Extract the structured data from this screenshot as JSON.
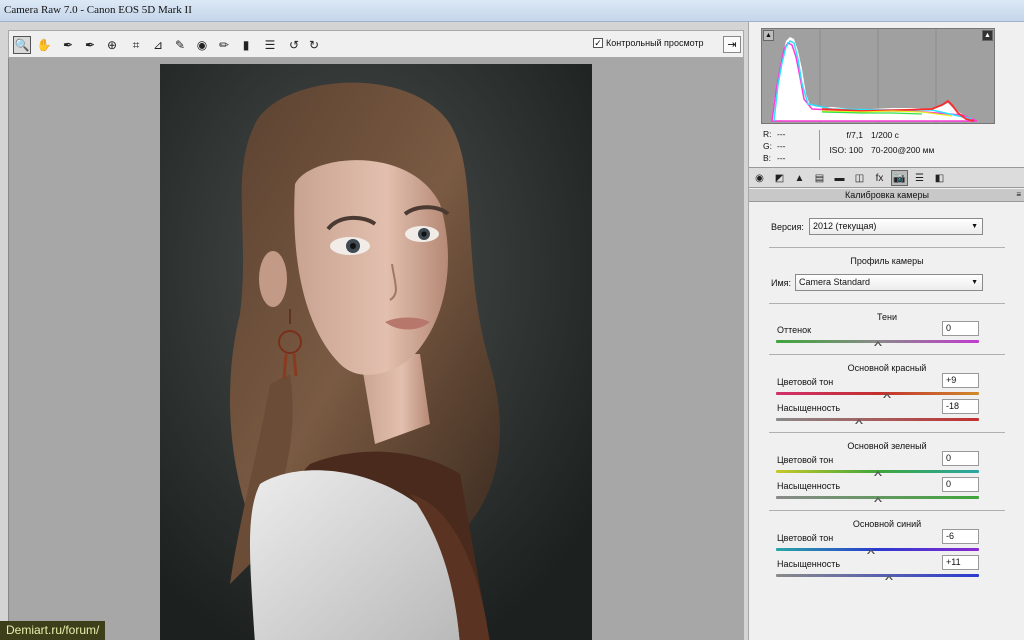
{
  "window": {
    "title": "Camera Raw 7.0  -  Canon EOS 5D Mark II"
  },
  "toolbar": {
    "tools": [
      {
        "name": "zoom-tool-icon",
        "glyph": "🔍"
      },
      {
        "name": "hand-tool-icon",
        "glyph": "✋"
      },
      {
        "name": "white-balance-tool-icon",
        "glyph": "✒"
      },
      {
        "name": "color-sampler-tool-icon",
        "glyph": "✒"
      },
      {
        "name": "targeted-adjustment-tool-icon",
        "glyph": "⊕"
      },
      {
        "name": "crop-tool-icon",
        "glyph": "⌗"
      },
      {
        "name": "straighten-tool-icon",
        "glyph": "⊿"
      },
      {
        "name": "spot-removal-tool-icon",
        "glyph": "✎"
      },
      {
        "name": "red-eye-tool-icon",
        "glyph": "◉"
      },
      {
        "name": "adjustment-brush-icon",
        "glyph": "✏"
      },
      {
        "name": "graduated-filter-icon",
        "glyph": "▮"
      },
      {
        "name": "preferences-icon",
        "glyph": "☰"
      },
      {
        "name": "rotate-ccw-icon",
        "glyph": "↺"
      },
      {
        "name": "rotate-cw-icon",
        "glyph": "↻"
      }
    ],
    "preview_label": "Контрольный просмотр",
    "preview_checked": "✓"
  },
  "info": {
    "r": "R:",
    "g": "G:",
    "b": "B:",
    "r_val": "---",
    "g_val": "---",
    "b_val": "---",
    "aperture": "f/7,1",
    "shutter": "1/200 с",
    "iso": "ISO: 100",
    "lens": "70-200@200 мм"
  },
  "panel": {
    "title": "Калибровка камеры",
    "version_label": "Версия:",
    "version_value": "2012 (текущая)",
    "profile_heading": "Профиль камеры",
    "name_label": "Имя:",
    "name_value": "Camera Standard",
    "shadows": {
      "heading": "Тени",
      "tint_label": "Оттенок",
      "tint_value": "0"
    },
    "red": {
      "heading": "Основной красный",
      "hue_label": "Цветовой тон",
      "hue_value": "+9",
      "sat_label": "Насыщенность",
      "sat_value": "-18"
    },
    "green": {
      "heading": "Основной зеленый",
      "hue_label": "Цветовой тон",
      "hue_value": "0",
      "sat_label": "Насыщенность",
      "sat_value": "0"
    },
    "blue": {
      "heading": "Основной синий",
      "hue_label": "Цветовой тон",
      "hue_value": "-6",
      "sat_label": "Насыщенность",
      "sat_value": "+11"
    }
  },
  "sliders": {
    "shadows_tint": 0,
    "red_hue": 9,
    "red_sat": -18,
    "green_hue": 0,
    "green_sat": 0,
    "blue_hue": -6,
    "blue_sat": 11,
    "range": [
      -100,
      100
    ]
  },
  "watermark": "Demiart.ru/forum/"
}
